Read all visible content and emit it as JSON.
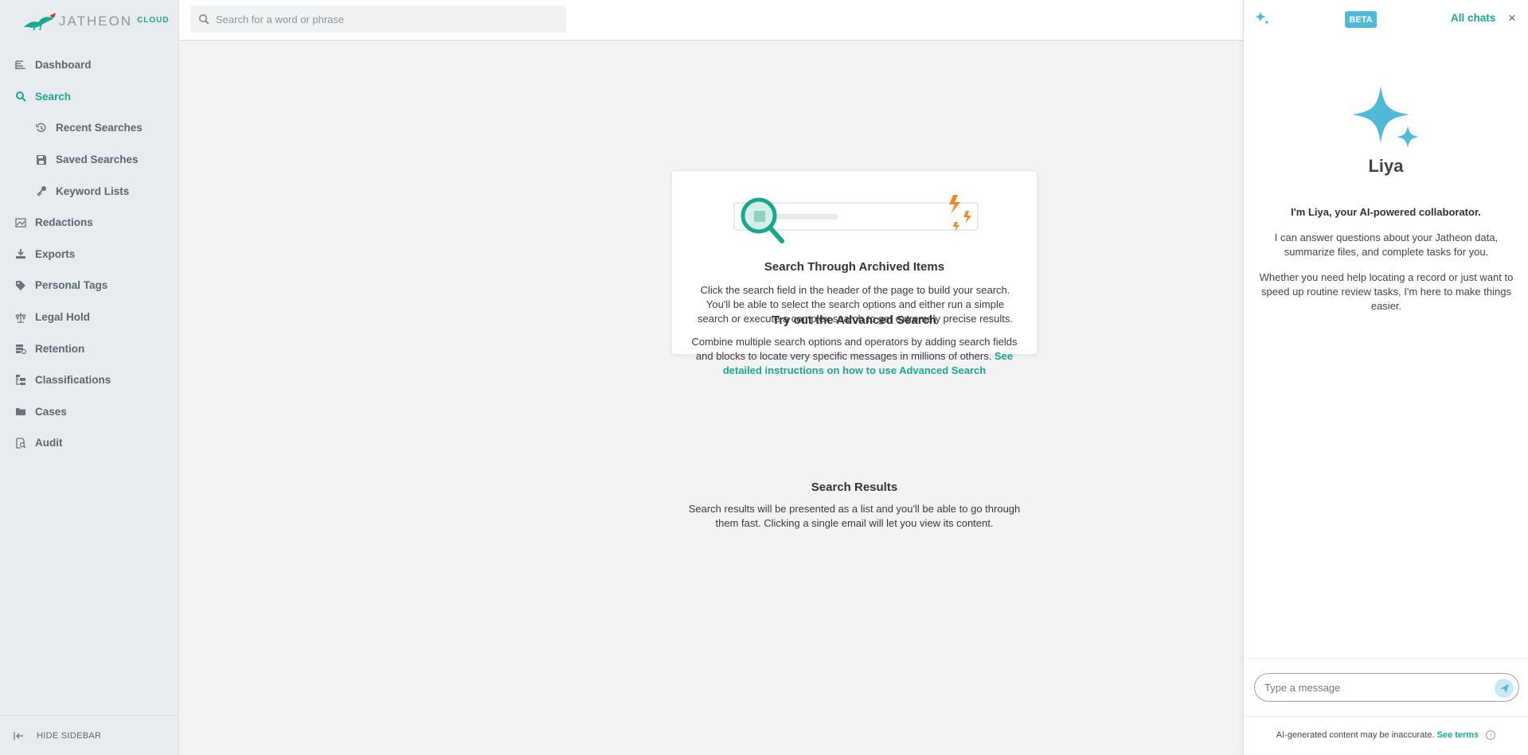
{
  "brand": {
    "name": "JATHEON",
    "suffix": "CLOUD"
  },
  "header": {
    "search_placeholder": "Search for a word or phrase"
  },
  "sidebar": {
    "items": [
      {
        "label": "Dashboard",
        "icon": "dashboard-icon"
      },
      {
        "label": "Search",
        "icon": "search-icon",
        "active": true
      },
      {
        "label": "Recent Searches",
        "icon": "history-icon",
        "sub": true
      },
      {
        "label": "Saved Searches",
        "icon": "save-icon",
        "sub": true
      },
      {
        "label": "Keyword Lists",
        "icon": "key-icon",
        "sub": true
      },
      {
        "label": "Redactions",
        "icon": "redaction-icon"
      },
      {
        "label": "Exports",
        "icon": "export-icon"
      },
      {
        "label": "Personal Tags",
        "icon": "tag-icon"
      },
      {
        "label": "Legal Hold",
        "icon": "scale-icon"
      },
      {
        "label": "Retention",
        "icon": "retention-icon"
      },
      {
        "label": "Classifications",
        "icon": "classification-icon"
      },
      {
        "label": "Cases",
        "icon": "folder-icon"
      },
      {
        "label": "Audit",
        "icon": "audit-icon"
      }
    ],
    "hide_label": "HIDE SIDEBAR"
  },
  "main": {
    "card": {
      "title": "Search Through Archived Items",
      "text": "Click the search field in the header of the page to build your search. You'll be able to select the search options and either run a simple search or execute a complex search to get extremely precise results."
    },
    "advanced": {
      "title": "Try out the Advanced Search",
      "text": "Combine multiple search options and operators by adding search fields and blocks to locate very specific messages in millions of others.",
      "link": "See detailed instructions on how to use Advanced Search"
    },
    "results": {
      "title": "Search Results",
      "text": "Search results will be presented as a list and you'll be able to go through them fast. Clicking a single email will let you view its content."
    }
  },
  "ai_panel": {
    "badge": "BETA",
    "all_chats": "All chats",
    "close": "×",
    "name": "Liya",
    "intro": "I'm Liya, your AI-powered collaborator.",
    "text1": "I can answer questions about your Jatheon data, summarize files, and complete tasks for you.",
    "text2": "Whether you need help locating a record or just want to speed up routine review tasks, I'm here to make things easier.",
    "message_placeholder": "Type a message",
    "disclaimer": "AI-generated content may be inaccurate.",
    "terms": "See terms"
  },
  "colors": {
    "accent": "#1aa88d",
    "ai_blue": "#4fb9d8",
    "sidebar_bg": "#e9ecef",
    "orange": "#f08a24"
  }
}
